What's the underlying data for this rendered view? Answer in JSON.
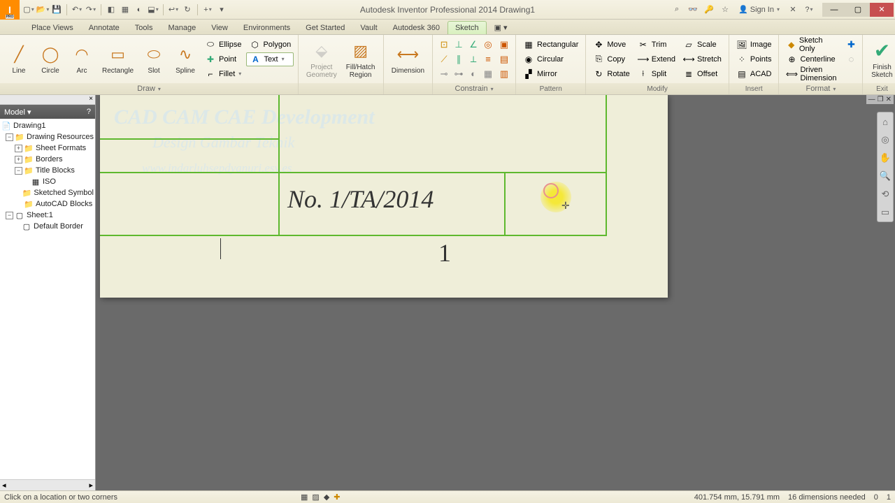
{
  "title": "Autodesk Inventor Professional 2014   Drawing1",
  "signin": "Sign In",
  "tabs": [
    "Place Views",
    "Annotate",
    "Tools",
    "Manage",
    "View",
    "Environments",
    "Get Started",
    "Vault",
    "Autodesk 360",
    "Sketch"
  ],
  "draw": {
    "line": "Line",
    "circle": "Circle",
    "arc": "Arc",
    "rect": "Rectangle",
    "slot": "Slot",
    "spline": "Spline",
    "ellipse": "Ellipse",
    "polygon": "Polygon",
    "point": "Point",
    "text": "Text",
    "fillet": "Fillet",
    "label": "Draw"
  },
  "create": {
    "project": "Project Geometry",
    "fill": "Fill/Hatch Region"
  },
  "dimension": "Dimension",
  "constrain": "Constrain",
  "pattern": {
    "rect": "Rectangular",
    "circ": "Circular",
    "mirror": "Mirror",
    "label": "Pattern"
  },
  "modify": {
    "move": "Move",
    "copy": "Copy",
    "rotate": "Rotate",
    "trim": "Trim",
    "extend": "Extend",
    "split": "Split",
    "scale": "Scale",
    "stretch": "Stretch",
    "offset": "Offset",
    "label": "Modify"
  },
  "insert": {
    "image": "Image",
    "points": "Points",
    "acad": "ACAD",
    "label": "Insert"
  },
  "format": {
    "sketch": "Sketch Only",
    "center": "Centerline",
    "driven": "Driven Dimension",
    "label": "Format"
  },
  "exit": {
    "finish": "Finish Sketch",
    "label": "Exit"
  },
  "browser": {
    "title": "Model",
    "root": "Drawing1",
    "resources": "Drawing Resources",
    "sheetformats": "Sheet Formats",
    "borders": "Borders",
    "titleblocks": "Title Blocks",
    "iso": "ISO",
    "sketched": "Sketched Symbol",
    "autocad": "AutoCAD Blocks",
    "sheet": "Sheet:1",
    "defborder": "Default Border"
  },
  "canvas": {
    "wm1": "CAD CAM CAE Development",
    "wm2": "Design Gambar Teknik",
    "wm3": "www.indarluhsepdyanuri.esy.es",
    "text1": "No. 1/TA/2014",
    "num": "1"
  },
  "status": {
    "prompt": "Click on a location or two corners",
    "coords": "401.754 mm, 15.791 mm",
    "dims": "16 dimensions needed",
    "n1": "0",
    "n2": "1"
  }
}
